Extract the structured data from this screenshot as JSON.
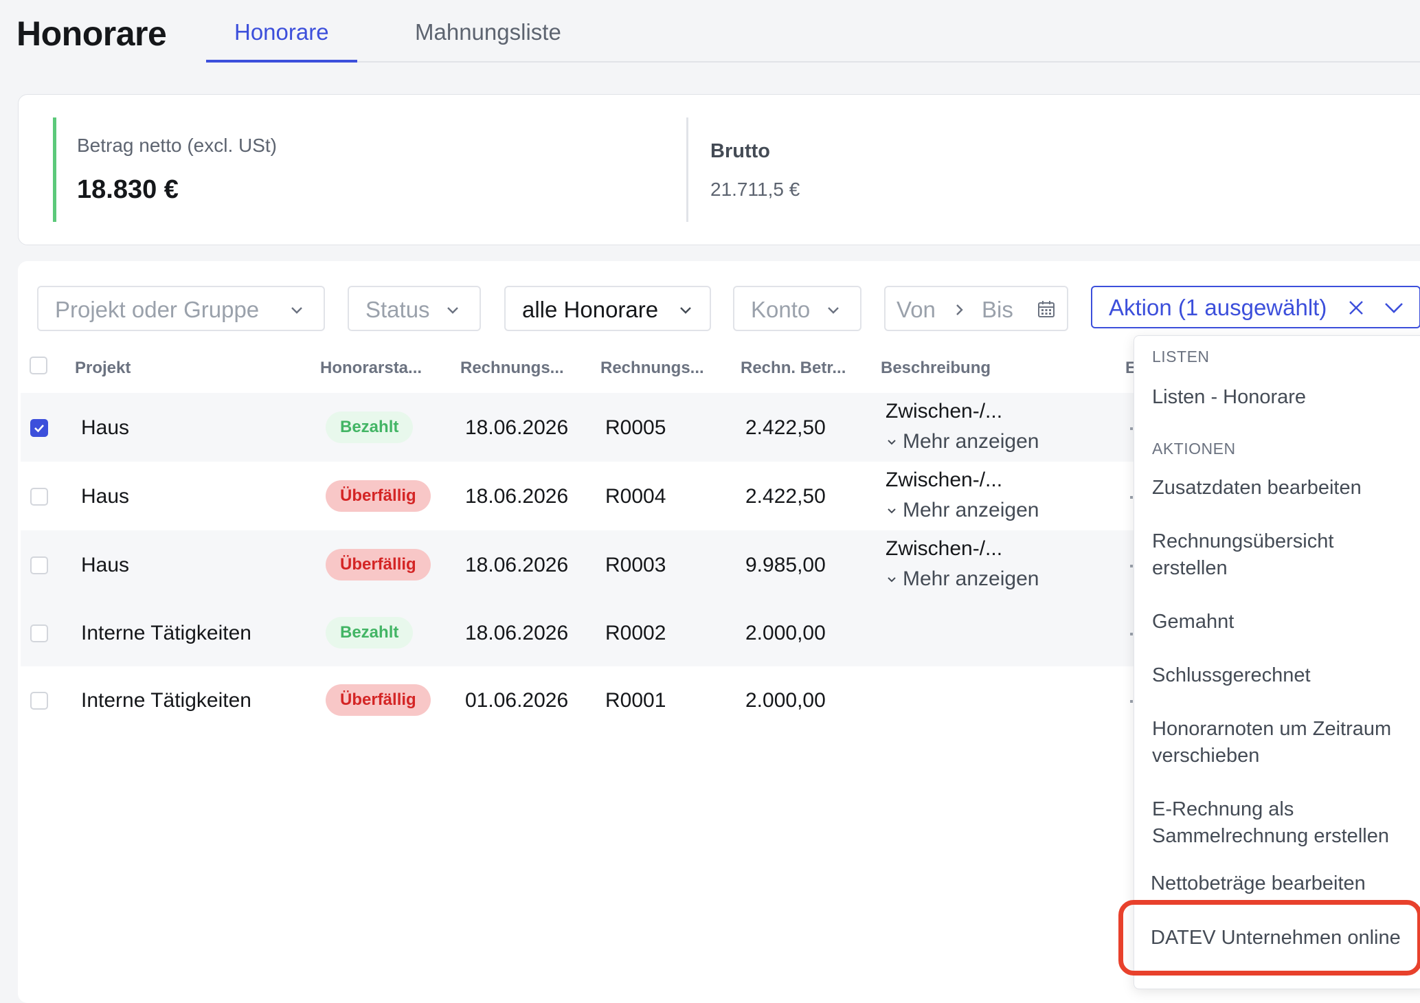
{
  "header": {
    "title": "Honorare",
    "tabs": [
      {
        "label": "Honorare",
        "active": true
      },
      {
        "label": "Mahnungsliste",
        "active": false
      }
    ]
  },
  "summary": {
    "netto_label": "Betrag netto (excl. USt)",
    "netto_value": "18.830 €",
    "brutto_label": "Brutto",
    "brutto_value": "21.711,5 €",
    "accent_color": "#5cc97a"
  },
  "filters": {
    "projekt": "Projekt oder Gruppe",
    "status": "Status",
    "honorare": "alle Honorare",
    "konto": "Konto",
    "von": "Von",
    "bis": "Bis",
    "aktion": "Aktion (1 ausgewählt)"
  },
  "table": {
    "columns": [
      "Projekt",
      "Honorarsta...",
      "Rechnungs...",
      "Rechnungs...",
      "Rechn. Betr...",
      "Beschreibung",
      "E"
    ],
    "rows": [
      {
        "selected": true,
        "projekt": "Haus",
        "status": "Bezahlt",
        "status_type": "paid",
        "datum": "18.06.2026",
        "nummer": "R0005",
        "betrag": "2.422,50",
        "beschreibung": "Zwischen-/...",
        "mehr": "Mehr anzeigen"
      },
      {
        "selected": false,
        "projekt": "Haus",
        "status": "Überfällig",
        "status_type": "overdue",
        "datum": "18.06.2026",
        "nummer": "R0004",
        "betrag": "2.422,50",
        "beschreibung": "Zwischen-/...",
        "mehr": "Mehr anzeigen"
      },
      {
        "selected": false,
        "projekt": "Haus",
        "status": "Überfällig",
        "status_type": "overdue",
        "datum": "18.06.2026",
        "nummer": "R0003",
        "betrag": "9.985,00",
        "beschreibung": "Zwischen-/...",
        "mehr": "Mehr anzeigen"
      },
      {
        "selected": false,
        "projekt": "Interne Tätigkeiten",
        "status": "Bezahlt",
        "status_type": "paid",
        "datum": "18.06.2026",
        "nummer": "R0002",
        "betrag": "2.000,00",
        "beschreibung": "",
        "mehr": ""
      },
      {
        "selected": false,
        "projekt": "Interne Tätigkeiten",
        "status": "Überfällig",
        "status_type": "overdue",
        "datum": "01.06.2026",
        "nummer": "R0001",
        "betrag": "2.000,00",
        "beschreibung": "",
        "mehr": ""
      }
    ]
  },
  "dropdown": {
    "section_listen": "LISTEN",
    "listen_honorare": "Listen - Honorare",
    "section_aktionen": "AKTIONEN",
    "items": [
      "Zusatzdaten bearbeiten",
      "Rechnungsübersicht erstellen",
      "Gemahnt",
      "Schlussgerechnet",
      "Honorarnoten um Zeitraum verschieben",
      "E-Rechnung als Sammelrechnung erstellen",
      "Nettobeträge bearbeiten",
      "DATEV Unternehmen online"
    ]
  },
  "colors": {
    "primary": "#3c4fdb",
    "paid_text": "#43b565",
    "paid_bg": "#e8f8ec",
    "overdue_text": "#d42525",
    "overdue_bg": "#f8c7c7",
    "highlight": "#e8412c"
  }
}
